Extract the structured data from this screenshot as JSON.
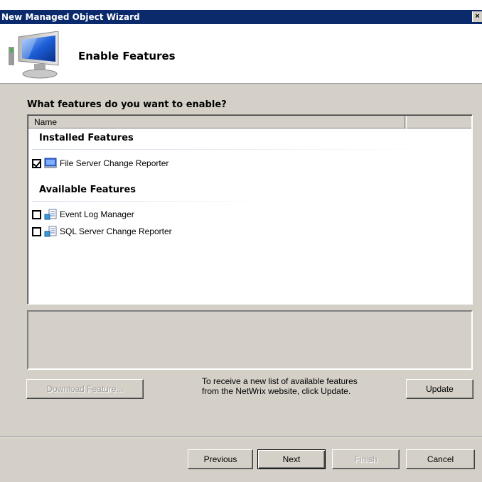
{
  "window": {
    "title": "New Managed Object Wizard",
    "close_label": "×"
  },
  "header": {
    "heading": "Enable Features",
    "icon": "monitor-icon"
  },
  "question": "What features do you want to enable?",
  "list": {
    "column_name": "Name",
    "installed": {
      "title": "Installed Features",
      "items": [
        {
          "label": "File Server Change Reporter",
          "checked": true,
          "icon": "file-server-icon"
        }
      ]
    },
    "available": {
      "title": "Available Features",
      "items": [
        {
          "label": "Event Log Manager",
          "checked": false,
          "icon": "package-icon"
        },
        {
          "label": "SQL Server Change Reporter",
          "checked": false,
          "icon": "package-icon"
        }
      ]
    }
  },
  "download": {
    "label": "Download Feature..."
  },
  "update": {
    "info_line1": "To receive a new list of available features",
    "info_line2": "from the NetWrix website, click Update.",
    "label": "Update"
  },
  "nav": {
    "previous": "Previous",
    "next": "Next",
    "finish": "Finish",
    "cancel": "Cancel"
  },
  "colors": {
    "titlebar": "#0b2a6b",
    "dialog": "#d4d0c8"
  }
}
